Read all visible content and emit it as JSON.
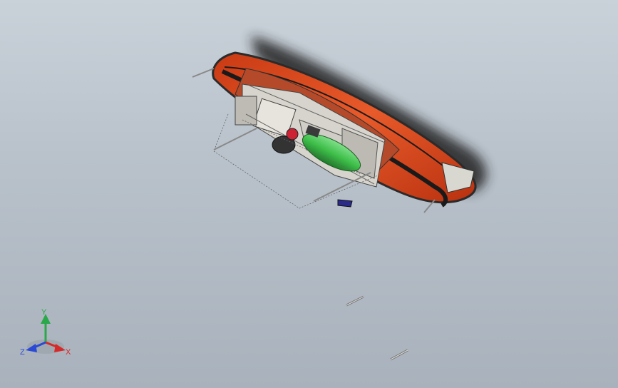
{
  "viewport": {
    "background_top": "#c9d1d9",
    "background_bottom": "#a9b2bc"
  },
  "model": {
    "hull_color": "#e0461c",
    "hull_dark": "#2b2b2b",
    "part_gray": "#d8d8d0",
    "tank_color": "#3fbf4a",
    "line_color": "#555555"
  },
  "triad": {
    "x_label": "X",
    "y_label": "Y",
    "z_label": "Z",
    "x_color": "#d62a2a",
    "y_color": "#2aa84a",
    "z_color": "#2a4ad6"
  }
}
